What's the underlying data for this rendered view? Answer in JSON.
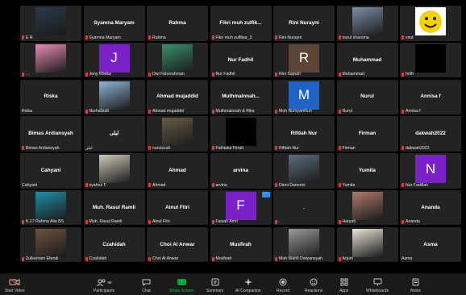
{
  "participants": [
    {
      "label": "E R",
      "tile_name": "",
      "avatar": "photo",
      "avatar_color": "#2a3a4d",
      "mic_off": true
    },
    {
      "label": "Syamna Maryam",
      "tile_name": "Syamna Maryam",
      "mic_off": true
    },
    {
      "label": "Rahma",
      "tile_name": "Rahma",
      "mic_off": true
    },
    {
      "label": "Fikri muh zulfikar_3",
      "tile_name": "Fikri muh zulfik...",
      "mic_off": true
    },
    {
      "label": "Rini Nurayni",
      "tile_name": "Rini Nurayni",
      "mic_off": true
    },
    {
      "label": "nurul sharoma",
      "tile_name": "",
      "avatar": "photo",
      "avatar_color": "#7b8ea6",
      "mic_off": true
    },
    {
      "label": "vind",
      "tile_name": "",
      "avatar": "smiley",
      "avatar_color": "#f5d10a",
      "mic_off": true
    },
    {
      "label": ". .",
      "tile_name": "",
      "avatar": "photo",
      "avatar_color": "#e88bb7",
      "mic_off": true
    },
    {
      "label": "Jeny Rheka",
      "tile_name": "",
      "avatar": "letter",
      "letter": "J",
      "avatar_color": "#7a22c7",
      "mic_off": true
    },
    {
      "label": "Dwi Faturrahman",
      "tile_name": "",
      "avatar": "photo",
      "avatar_color": "#3a8f6a",
      "mic_off": true
    },
    {
      "label": "Nur Fadhil",
      "tile_name": "Nur Fadhil",
      "mic_off": true
    },
    {
      "label": "Rini Saputri",
      "tile_name": "",
      "avatar": "letter",
      "letter": "R",
      "avatar_color": "#5c4437",
      "mic_off": true
    },
    {
      "label": "Muhammad",
      "tile_name": "Muhammad",
      "mic_off": true
    },
    {
      "label": "hnfh",
      "tile_name": "",
      "avatar": "dark",
      "avatar_color": "#000000",
      "mic_off": true
    },
    {
      "label": "Riska",
      "tile_name": "Riska",
      "mic_off": false
    },
    {
      "label": "Nurhalizah",
      "tile_name": "",
      "avatar": "photo",
      "avatar_color": "#8db4d6",
      "mic_off": true
    },
    {
      "label": "Ahmad mujaddid",
      "tile_name": "Ahmad mujaddid",
      "mic_off": true
    },
    {
      "label": "Muthmainnah & Rika",
      "tile_name": "Muthmainnah...",
      "mic_off": true
    },
    {
      "label": "Muh Nursyamhuri",
      "tile_name": "",
      "avatar": "letter",
      "letter": "M",
      "avatar_color": "#1f63c4",
      "mic_off": true
    },
    {
      "label": "Nurul",
      "tile_name": "Nurul",
      "mic_off": true
    },
    {
      "label": "Annisa f",
      "tile_name": "Annisa f",
      "mic_off": true
    },
    {
      "label": "Bimas Ardiansyah",
      "tile_name": "Bimas Ardiansyah",
      "mic_off": true
    },
    {
      "label": "ليلى",
      "tile_name": "ليلى",
      "mic_off": false
    },
    {
      "label": "nurulzzah",
      "tile_name": "",
      "avatar": "photo",
      "avatar_color": "#6a5a45",
      "mic_off": true
    },
    {
      "label": "Fathiatul Fitrah",
      "tile_name": "",
      "avatar": "dark",
      "avatar_color": "#000000",
      "mic_off": true
    },
    {
      "label": "Rifdah Nur",
      "tile_name": "Rifdah Nur",
      "mic_off": true
    },
    {
      "label": "Firman",
      "tile_name": "Firman",
      "mic_off": true
    },
    {
      "label": "dakwah2022",
      "tile_name": "dakwah2022",
      "mic_off": true
    },
    {
      "label": "Cahyani",
      "tile_name": "Cahyani",
      "mic_off": false
    },
    {
      "label": "syahrul F",
      "tile_name": "",
      "avatar": "photo",
      "avatar_color": "#cfcab8",
      "mic_off": true
    },
    {
      "label": "Ahmad",
      "tile_name": "Ahmad",
      "mic_off": true
    },
    {
      "label": "arvina",
      "tile_name": "arvina",
      "mic_off": true
    },
    {
      "label": "Dieni Damoris",
      "tile_name": "",
      "avatar": "photo",
      "avatar_color": "#5d6c7e",
      "mic_off": true
    },
    {
      "label": "Yumita",
      "tile_name": "Yumita",
      "mic_off": true
    },
    {
      "label": "Nur Fadillah",
      "tile_name": "",
      "avatar": "letter",
      "letter": "N",
      "avatar_color": "#7a22c7",
      "mic_off": true
    },
    {
      "label": "K.17 Rahma Alia BS",
      "tile_name": "",
      "avatar": "photo",
      "avatar_color": "#1e8fa8",
      "mic_off": true
    },
    {
      "label": "Muh. Rasul Ramli",
      "tile_name": "Muh. Rasul Ramli",
      "mic_off": true
    },
    {
      "label": "Ainul Fitri",
      "tile_name": "Ainul Fitri",
      "mic_off": true
    },
    {
      "label": "Faizah Amri",
      "tile_name": "",
      "avatar": "letter",
      "letter": "F",
      "avatar_color": "#7a22c7",
      "mic_off": true,
      "more": true
    },
    {
      "label": ".",
      "tile_name": ".",
      "mic_off": true
    },
    {
      "label": "Haryati",
      "tile_name": "",
      "avatar": "photo",
      "avatar_color": "#b07a6a",
      "mic_off": true
    },
    {
      "label": "Ananda",
      "tile_name": "Ananda",
      "mic_off": true
    },
    {
      "label": "Zulkarnain Efendi",
      "tile_name": "",
      "avatar": "photo",
      "avatar_color": "#6b5140",
      "mic_off": true
    },
    {
      "label": "Czahidah",
      "tile_name": "Czahidah",
      "mic_off": true
    },
    {
      "label": "Choi Al Anwar",
      "tile_name": "Choi Al Anwar",
      "mic_off": true
    },
    {
      "label": "Musfirah",
      "tile_name": "Musfirah",
      "mic_off": true
    },
    {
      "label": "Muh Wahfi Dwiyansyah",
      "tile_name": "",
      "avatar": "photo",
      "avatar_color": "#9a9a9a",
      "mic_off": true
    },
    {
      "label": "Arjuni",
      "tile_name": "",
      "avatar": "photo",
      "avatar_color": "#e9e4d6",
      "mic_off": true
    },
    {
      "label": "Asma",
      "tile_name": "Asma",
      "mic_off": false
    }
  ],
  "toolbar": {
    "start_video": "Start Video",
    "participants": "Participants",
    "participants_count": "88",
    "chat": "Chat",
    "share_screen": "Share Screen",
    "summary": "Summary",
    "ai_companion": "AI Companion",
    "record": "Record",
    "reactions": "Reactions",
    "apps": "Apps",
    "whiteboards": "Whiteboards",
    "notes": "Notes"
  },
  "colors": {
    "tile_bg": "#232323",
    "mic_muted": "#e53935",
    "share_green": "#0e9f45",
    "accent_blue": "#2d8cff"
  }
}
